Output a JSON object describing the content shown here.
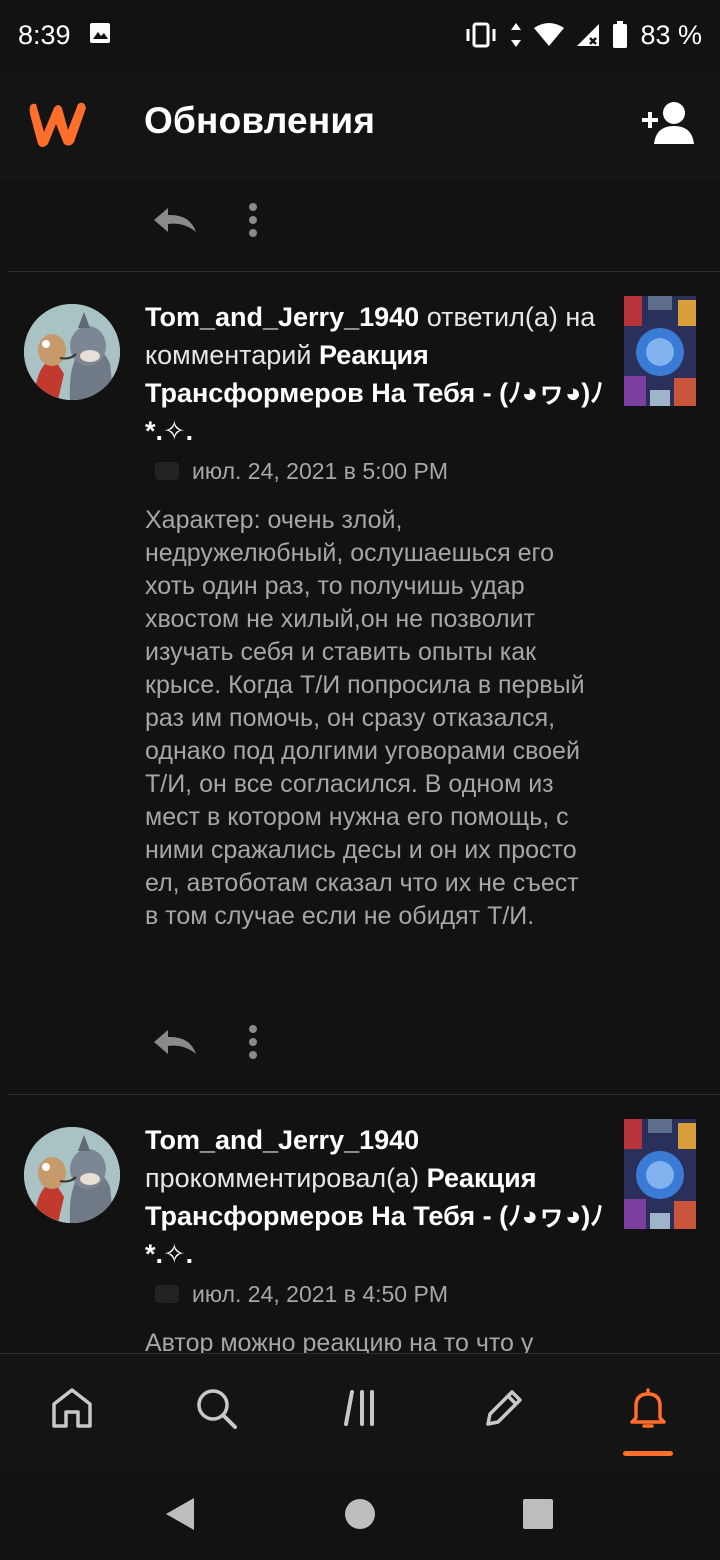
{
  "status_bar": {
    "time": "8:39",
    "battery": "83 %"
  },
  "app_bar": {
    "title": "Обновления"
  },
  "notifications": [
    {
      "user": "Tom_and_Jerry_1940",
      "action": "ответил(а) на комментарий",
      "story": "Реакция Трансформеров На Тебя - (ﾉ◕ヮ◕)ﾉ*.✧.",
      "timestamp": "июл. 24, 2021 в 5:00 PM",
      "text": "Характер: очень злой, недружелюбный, ослушаешься его хоть один раз, то получишь удар хвостом не хилый,он не позволит изучать себя и ставить опыты как крысе. Когда Т/И попросила в первый раз им помочь, он сразу отказался, однако под долгими уговорами своей Т/И, он все согласился. В одном из мест в котором нужна его помощь, с ними сражались десы и он их просто ел, автоботам сказал что их не съест в том случае если не обидят Т/И."
    },
    {
      "user": "Tom_and_Jerry_1940",
      "action": "прокомментировал(а)",
      "story": "Реакция Трансформеров На Тебя - (ﾉ◕ヮ◕)ﾉ*.✧.",
      "timestamp": "июл. 24, 2021 в 4:50 PM",
      "text": "Автор можно реакцию на то что у"
    }
  ],
  "colors": {
    "accent": "#ff6e2b",
    "background": "#121212",
    "body_text": "#a6a6a6"
  },
  "bottom_nav": {
    "items": [
      "home-icon",
      "search-icon",
      "library-icon",
      "write-icon",
      "notifications-icon"
    ],
    "active": "notifications-icon"
  }
}
